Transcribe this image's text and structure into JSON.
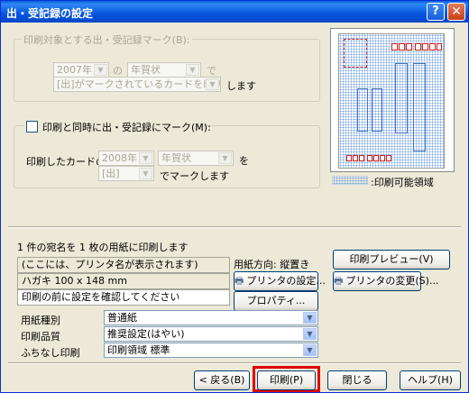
{
  "window": {
    "title": "出・受記録の設定",
    "help_glyph": "?",
    "close_glyph": "✕"
  },
  "print_target_group": {
    "legend": "印刷対象とする出・受記録マーク(B):",
    "year_value": "2007年",
    "connector_no": "の",
    "type_value": "年賀状",
    "connector_de": "で",
    "condition_value": "[出]がマークされているカードを印刷",
    "suffix": "します"
  },
  "mark_group": {
    "checkbox_label": "印刷と同時に出・受記録にマーク(M):",
    "row_label": "印刷したカードの",
    "year_value": "2008年",
    "type_value": "年賀状",
    "particle": "を",
    "mark_value": "[出]",
    "suffix": "でマークします"
  },
  "preview": {
    "legend_text": ":印刷可能領域"
  },
  "summary": {
    "print_count_text": "1 件の宛名を 1 枚の用紙に印刷します",
    "paper_direction": "用紙方向: 縦置き",
    "printer_name": "(ここには、プリンタ名が表示されます)",
    "paper_size": "ハガキ 100 x 148 mm",
    "notice": "印刷の前に設定を確認してください"
  },
  "buttons": {
    "print_preview": "印刷プレビュー(V)",
    "printer_settings": "プリンタの設定...",
    "printer_change": "プリンタの変更(S)...",
    "properties": "プロパティ...",
    "back": "< 戻る(B)",
    "print": "印刷(P)",
    "close": "閉じる",
    "help": "ヘルプ(H)"
  },
  "options": {
    "paper_type_label": "用紙種別",
    "paper_type_value": "普通紙",
    "quality_label": "印刷品質",
    "quality_value": "推奨設定(はやい)",
    "borderless_label": "ふちなし印刷",
    "borderless_value": "印刷領域 標準"
  },
  "colors": {
    "title_bar": "#0655df",
    "dialog_bg": "#ece9d8",
    "highlight": "#e00000"
  }
}
